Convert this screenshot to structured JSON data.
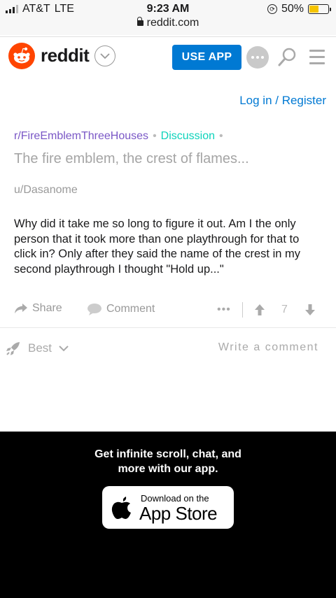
{
  "status_bar": {
    "carrier": "AT&T",
    "network": "LTE",
    "time": "9:23 AM",
    "battery_percent": "50%",
    "battery_level": 0.5,
    "battery_color": "#f5c400"
  },
  "browser": {
    "url": "reddit.com"
  },
  "header": {
    "logo_text": "reddit",
    "use_app_label": "USE APP",
    "accent_color": "#0079d3",
    "brand_color": "#ff4500",
    "icons": [
      "reddit-snoo-icon",
      "chevron-down-icon",
      "chat-icon",
      "search-icon",
      "menu-icon"
    ]
  },
  "auth": {
    "login_label": "Log in / Register"
  },
  "post": {
    "subreddit": "r/FireEmblemThreeHouses",
    "flair": "Discussion",
    "title": "The fire emblem, the crest of flames...",
    "author": "u/Dasanome",
    "body": "Why did it take me so long to figure it out. Am I the only person that it took more than one playthrough for that to click in? Only after they said the name of the crest in my second playthrough I thought \"Hold up...\"",
    "share_label": "Share",
    "comment_label": "Comment",
    "more_label": "•••",
    "score": "7"
  },
  "comments": {
    "sort_label": "Best",
    "write_placeholder": "Write a comment"
  },
  "promo": {
    "line1": "Get infinite scroll, chat, and",
    "line2": "more with our app.",
    "store_small": "Download on the",
    "store_big": "App Store"
  }
}
